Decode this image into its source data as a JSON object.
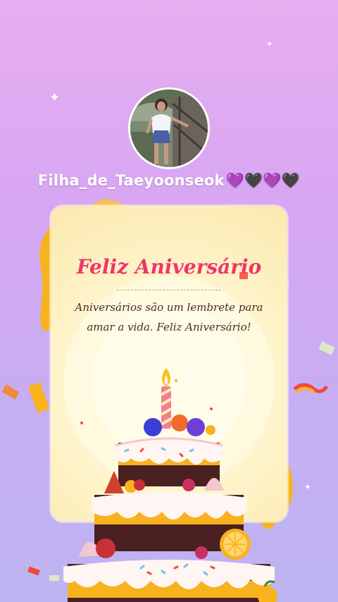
{
  "profile": {
    "username": "Filha_de_Taeyoonseok",
    "username_emoji": "💜🖤💜🖤"
  },
  "card": {
    "title": "Feliz Aniversário",
    "message": "Aniversários são um lembrete para amar a vida. Feliz Aniversário!"
  },
  "icons": {
    "sparkle": "✦"
  },
  "colors": {
    "title": "#f0356d",
    "background_top": "#e7aef0",
    "background_bottom": "#bdb4f1",
    "ribbon": "#f8b21e"
  }
}
